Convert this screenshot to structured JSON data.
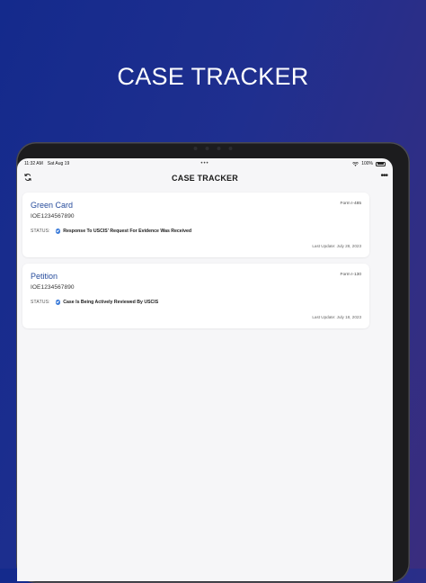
{
  "promo": {
    "title": "CASE TRACKER"
  },
  "status_bar": {
    "time": "11:32 AM",
    "date": "Sat Aug 19",
    "dots": "•••",
    "battery_pct": "100%"
  },
  "nav": {
    "title": "CASE TRACKER",
    "more": "•••"
  },
  "cases": [
    {
      "name": "Green Card",
      "form": "Form I-485",
      "receipt": "IOE1234567890",
      "status_label": "STATUS:",
      "status": "Response To USCIS' Request For Evidence Was Received",
      "last_update": "Last Update: July 28, 2023"
    },
    {
      "name": "Petition",
      "form": "Form I-130",
      "receipt": "IOE1234567890",
      "status_label": "STATUS:",
      "status": "Case Is Being Actively Reviewed By USCIS",
      "last_update": "Last Update: July 18, 2023"
    }
  ],
  "colors": {
    "accent": "#274c9c",
    "check": "#3b7bd9",
    "background_start": "#142a8c",
    "background_end": "#3a2d7e"
  }
}
